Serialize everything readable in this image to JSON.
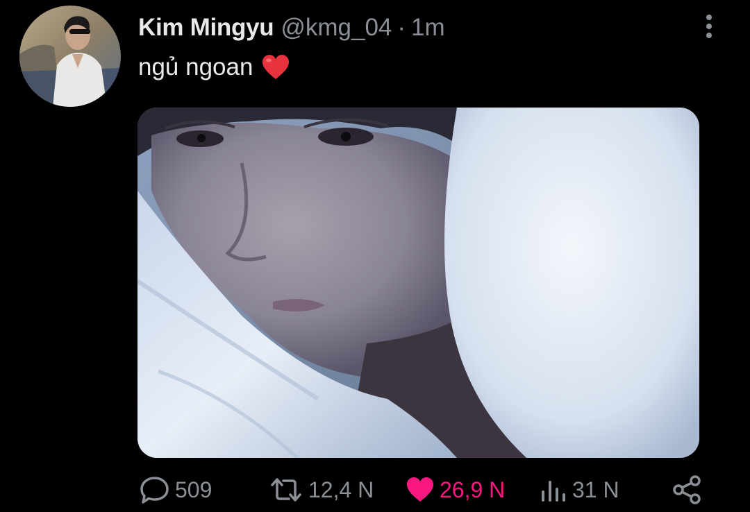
{
  "tweet": {
    "author_name": "Kim Mingyu",
    "handle": "@kmg_04",
    "separator": "·",
    "time": "1m",
    "text": "ngủ ngoan",
    "text_emoji": "red-heart-emoji"
  },
  "icons": {
    "more": "vertical-dots-icon",
    "reply": "speech-bubble-icon",
    "retweet": "retweet-arrows-icon",
    "like": "heart-filled-icon",
    "views": "bar-chart-icon",
    "share": "share-nodes-icon"
  },
  "actions": {
    "replies": "509",
    "retweets": "12,4 N",
    "likes": "26,9 N",
    "views": "31 N"
  },
  "colors": {
    "background": "#000000",
    "text_primary": "#e7e9ea",
    "text_secondary": "#8b9096",
    "like_active": "#f91880"
  }
}
